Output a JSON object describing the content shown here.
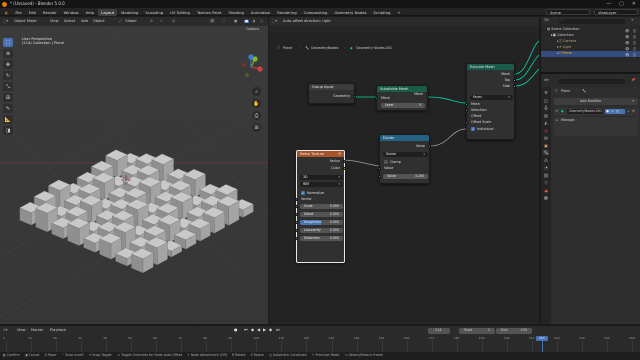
{
  "window": {
    "title": "* (Unsaved) - Blender 5.0.0",
    "minimize": "—",
    "maximize": "▢",
    "close": "✕"
  },
  "menubar": {
    "items": [
      "File",
      "Edit",
      "Render",
      "Window",
      "Help"
    ],
    "workspaces": [
      "Layout",
      "Modeling",
      "Sculpting",
      "UV Editing",
      "Texture Paint",
      "Shading",
      "Animation",
      "Rendering",
      "Compositing",
      "Geometry Nodes",
      "Scripting"
    ],
    "active_workspace": "Layout",
    "scene": "Scene",
    "view_layer": "ViewLayer"
  },
  "viewport": {
    "mode": "Object Mode",
    "menus": [
      "View",
      "Select",
      "Add",
      "Object"
    ],
    "transform": "Global",
    "options": "Options",
    "view_name": "User Perspective",
    "collection_line": "(214) Collection | Plane"
  },
  "node_editor": {
    "header_hint": "Auto-offset direction: right",
    "breadcrumb": [
      "Plane",
      "GeometryNodes",
      "Geometry Nodes.001"
    ],
    "group_input": {
      "title": "Group Input",
      "geometry": "Geometry"
    },
    "subdivide": {
      "title": "Subdivide Mesh",
      "output": "Mesh",
      "mesh": "Mesh",
      "level_label": "Level",
      "level_value": "3"
    },
    "extrude": {
      "title": "Extrude Mesh",
      "outputs": [
        "Mesh",
        "Top",
        "Side"
      ],
      "mode": "Faces",
      "inputs": [
        "Mesh",
        "Selection",
        "Offset",
        "Offset Scale"
      ],
      "individual": "Individual"
    },
    "divide": {
      "title": "Divide",
      "output": "Value",
      "operation": "Divide",
      "clamp": "Clamp",
      "value_label": "Value",
      "value2_label": "Value",
      "value2": "3.200"
    },
    "noise": {
      "title": "Noise Texture",
      "outputs": [
        "Factor",
        "Color"
      ],
      "dim": "3D",
      "type": "fBM",
      "normalize": "Normalize",
      "vector": "Vector",
      "fields": [
        {
          "label": "Scale",
          "value": "5.000"
        },
        {
          "label": "Detail",
          "value": "2.000"
        },
        {
          "label": "Roughness",
          "value": "0.500"
        },
        {
          "label": "Lacunarity",
          "value": "2.000"
        },
        {
          "label": "Distortion",
          "value": "0.000"
        }
      ]
    }
  },
  "outliner": {
    "items": [
      "Scene Collection",
      "Collection",
      "Camera",
      "Light",
      "Plane"
    ]
  },
  "properties": {
    "object": "Plane",
    "add_modifier": "Add Modifier",
    "modifier_name": "GeometryNodes.001",
    "manage": "Manage"
  },
  "timeline": {
    "menus": [
      "View",
      "Marker",
      "Playback"
    ],
    "current_frame": "214",
    "start_label": "Start",
    "start": "1",
    "end_label": "End",
    "end": "250",
    "ticks": [
      "0",
      "10",
      "20",
      "30",
      "40",
      "50",
      "60",
      "70",
      "80",
      "90",
      "100",
      "110",
      "120",
      "130",
      "140",
      "150",
      "160",
      "170",
      "180",
      "190",
      "200",
      "210",
      "220",
      "230",
      "240",
      "250"
    ]
  },
  "statusbar": {
    "items": [
      "Confirm",
      "Cancel",
      "Move",
      "Snap Invert",
      "Snap Toggle",
      "Toggle Overrides for Node Auto-Offset",
      "Node Attachment (Off)",
      "Rotate",
      "Resize",
      "Automatic Constraint",
      "Precision Mode",
      "Attach/Detach Frame"
    ]
  }
}
